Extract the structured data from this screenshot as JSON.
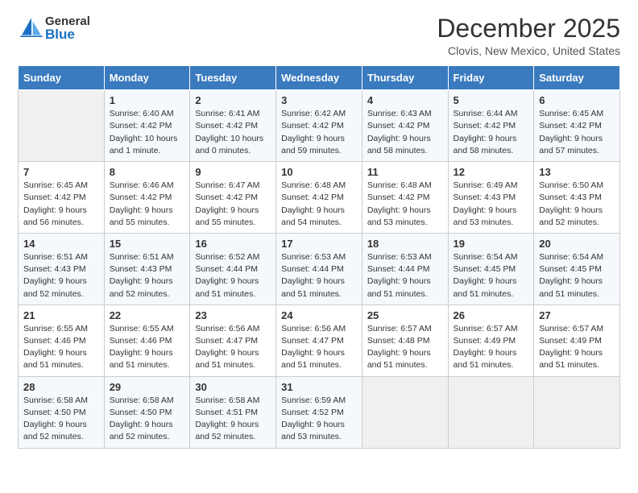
{
  "header": {
    "logo": {
      "general": "General",
      "blue": "Blue"
    },
    "title": "December 2025",
    "location": "Clovis, New Mexico, United States"
  },
  "calendar": {
    "days_of_week": [
      "Sunday",
      "Monday",
      "Tuesday",
      "Wednesday",
      "Thursday",
      "Friday",
      "Saturday"
    ],
    "weeks": [
      [
        {
          "day": "",
          "sunrise": "",
          "sunset": "",
          "daylight": ""
        },
        {
          "day": "1",
          "sunrise": "Sunrise: 6:40 AM",
          "sunset": "Sunset: 4:42 PM",
          "daylight": "Daylight: 10 hours and 1 minute."
        },
        {
          "day": "2",
          "sunrise": "Sunrise: 6:41 AM",
          "sunset": "Sunset: 4:42 PM",
          "daylight": "Daylight: 10 hours and 0 minutes."
        },
        {
          "day": "3",
          "sunrise": "Sunrise: 6:42 AM",
          "sunset": "Sunset: 4:42 PM",
          "daylight": "Daylight: 9 hours and 59 minutes."
        },
        {
          "day": "4",
          "sunrise": "Sunrise: 6:43 AM",
          "sunset": "Sunset: 4:42 PM",
          "daylight": "Daylight: 9 hours and 58 minutes."
        },
        {
          "day": "5",
          "sunrise": "Sunrise: 6:44 AM",
          "sunset": "Sunset: 4:42 PM",
          "daylight": "Daylight: 9 hours and 58 minutes."
        },
        {
          "day": "6",
          "sunrise": "Sunrise: 6:45 AM",
          "sunset": "Sunset: 4:42 PM",
          "daylight": "Daylight: 9 hours and 57 minutes."
        }
      ],
      [
        {
          "day": "7",
          "sunrise": "Sunrise: 6:45 AM",
          "sunset": "Sunset: 4:42 PM",
          "daylight": "Daylight: 9 hours and 56 minutes."
        },
        {
          "day": "8",
          "sunrise": "Sunrise: 6:46 AM",
          "sunset": "Sunset: 4:42 PM",
          "daylight": "Daylight: 9 hours and 55 minutes."
        },
        {
          "day": "9",
          "sunrise": "Sunrise: 6:47 AM",
          "sunset": "Sunset: 4:42 PM",
          "daylight": "Daylight: 9 hours and 55 minutes."
        },
        {
          "day": "10",
          "sunrise": "Sunrise: 6:48 AM",
          "sunset": "Sunset: 4:42 PM",
          "daylight": "Daylight: 9 hours and 54 minutes."
        },
        {
          "day": "11",
          "sunrise": "Sunrise: 6:48 AM",
          "sunset": "Sunset: 4:42 PM",
          "daylight": "Daylight: 9 hours and 53 minutes."
        },
        {
          "day": "12",
          "sunrise": "Sunrise: 6:49 AM",
          "sunset": "Sunset: 4:43 PM",
          "daylight": "Daylight: 9 hours and 53 minutes."
        },
        {
          "day": "13",
          "sunrise": "Sunrise: 6:50 AM",
          "sunset": "Sunset: 4:43 PM",
          "daylight": "Daylight: 9 hours and 52 minutes."
        }
      ],
      [
        {
          "day": "14",
          "sunrise": "Sunrise: 6:51 AM",
          "sunset": "Sunset: 4:43 PM",
          "daylight": "Daylight: 9 hours and 52 minutes."
        },
        {
          "day": "15",
          "sunrise": "Sunrise: 6:51 AM",
          "sunset": "Sunset: 4:43 PM",
          "daylight": "Daylight: 9 hours and 52 minutes."
        },
        {
          "day": "16",
          "sunrise": "Sunrise: 6:52 AM",
          "sunset": "Sunset: 4:44 PM",
          "daylight": "Daylight: 9 hours and 51 minutes."
        },
        {
          "day": "17",
          "sunrise": "Sunrise: 6:53 AM",
          "sunset": "Sunset: 4:44 PM",
          "daylight": "Daylight: 9 hours and 51 minutes."
        },
        {
          "day": "18",
          "sunrise": "Sunrise: 6:53 AM",
          "sunset": "Sunset: 4:44 PM",
          "daylight": "Daylight: 9 hours and 51 minutes."
        },
        {
          "day": "19",
          "sunrise": "Sunrise: 6:54 AM",
          "sunset": "Sunset: 4:45 PM",
          "daylight": "Daylight: 9 hours and 51 minutes."
        },
        {
          "day": "20",
          "sunrise": "Sunrise: 6:54 AM",
          "sunset": "Sunset: 4:45 PM",
          "daylight": "Daylight: 9 hours and 51 minutes."
        }
      ],
      [
        {
          "day": "21",
          "sunrise": "Sunrise: 6:55 AM",
          "sunset": "Sunset: 4:46 PM",
          "daylight": "Daylight: 9 hours and 51 minutes."
        },
        {
          "day": "22",
          "sunrise": "Sunrise: 6:55 AM",
          "sunset": "Sunset: 4:46 PM",
          "daylight": "Daylight: 9 hours and 51 minutes."
        },
        {
          "day": "23",
          "sunrise": "Sunrise: 6:56 AM",
          "sunset": "Sunset: 4:47 PM",
          "daylight": "Daylight: 9 hours and 51 minutes."
        },
        {
          "day": "24",
          "sunrise": "Sunrise: 6:56 AM",
          "sunset": "Sunset: 4:47 PM",
          "daylight": "Daylight: 9 hours and 51 minutes."
        },
        {
          "day": "25",
          "sunrise": "Sunrise: 6:57 AM",
          "sunset": "Sunset: 4:48 PM",
          "daylight": "Daylight: 9 hours and 51 minutes."
        },
        {
          "day": "26",
          "sunrise": "Sunrise: 6:57 AM",
          "sunset": "Sunset: 4:49 PM",
          "daylight": "Daylight: 9 hours and 51 minutes."
        },
        {
          "day": "27",
          "sunrise": "Sunrise: 6:57 AM",
          "sunset": "Sunset: 4:49 PM",
          "daylight": "Daylight: 9 hours and 51 minutes."
        }
      ],
      [
        {
          "day": "28",
          "sunrise": "Sunrise: 6:58 AM",
          "sunset": "Sunset: 4:50 PM",
          "daylight": "Daylight: 9 hours and 52 minutes."
        },
        {
          "day": "29",
          "sunrise": "Sunrise: 6:58 AM",
          "sunset": "Sunset: 4:50 PM",
          "daylight": "Daylight: 9 hours and 52 minutes."
        },
        {
          "day": "30",
          "sunrise": "Sunrise: 6:58 AM",
          "sunset": "Sunset: 4:51 PM",
          "daylight": "Daylight: 9 hours and 52 minutes."
        },
        {
          "day": "31",
          "sunrise": "Sunrise: 6:59 AM",
          "sunset": "Sunset: 4:52 PM",
          "daylight": "Daylight: 9 hours and 53 minutes."
        },
        {
          "day": "",
          "sunrise": "",
          "sunset": "",
          "daylight": ""
        },
        {
          "day": "",
          "sunrise": "",
          "sunset": "",
          "daylight": ""
        },
        {
          "day": "",
          "sunrise": "",
          "sunset": "",
          "daylight": ""
        }
      ]
    ]
  }
}
